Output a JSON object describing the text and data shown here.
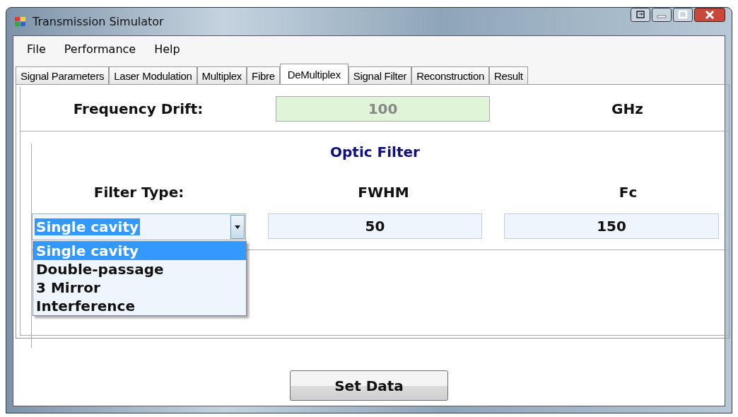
{
  "window": {
    "title": "Transmission Simulator"
  },
  "menu": [
    "File",
    "Performance",
    "Help"
  ],
  "tabs": [
    {
      "label": "Signal Parameters",
      "selected": false
    },
    {
      "label": "Laser Modulation",
      "selected": false
    },
    {
      "label": "Multiplex",
      "selected": false
    },
    {
      "label": "Fibre",
      "selected": false
    },
    {
      "label": "DeMultiplex",
      "selected": true
    },
    {
      "label": "Signal Filter",
      "selected": false
    },
    {
      "label": "Reconstruction",
      "selected": false
    },
    {
      "label": "Result",
      "selected": false
    }
  ],
  "frequency_drift": {
    "label": "Frequency Drift:",
    "value": "100",
    "unit": "GHz",
    "disabled": true
  },
  "optic_filter": {
    "title": "Optic Filter",
    "filter_type_label": "Filter Type:",
    "fwhm_label": "FWHM",
    "fc_label": "Fc",
    "filter_type": {
      "value": "Single cavity",
      "expanded": true,
      "options": [
        {
          "label": "Single cavity",
          "selected": true
        },
        {
          "label": "Double-passage",
          "selected": false
        },
        {
          "label": "3 Mirror",
          "selected": false
        },
        {
          "label": "Interference",
          "selected": false
        }
      ]
    },
    "fwhm": "50",
    "fc": "150"
  },
  "buttons": [
    "Set Data"
  ]
}
